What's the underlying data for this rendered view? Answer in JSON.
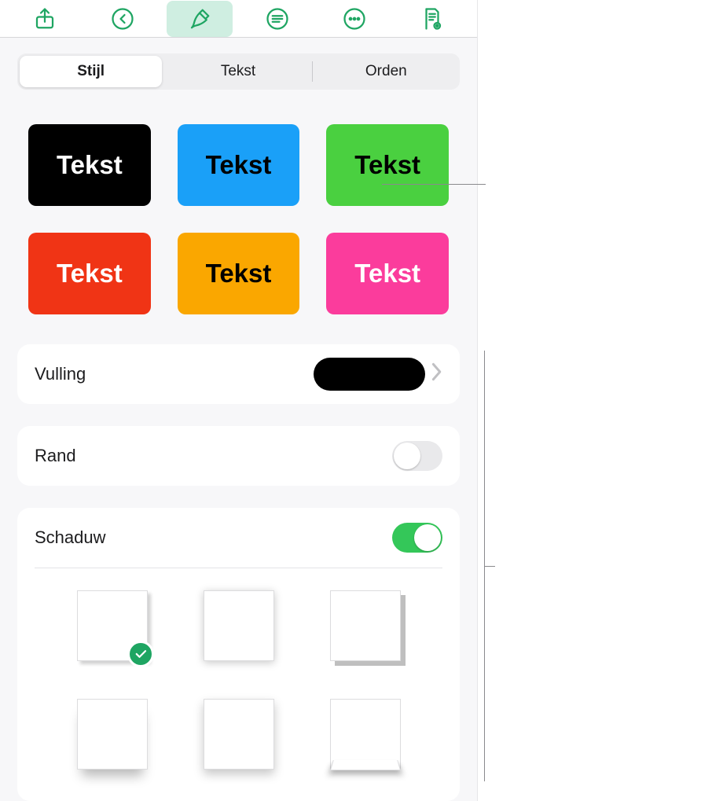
{
  "toolbar": {
    "icons": [
      "share-icon",
      "undo-icon",
      "format-brush-icon",
      "menu-lines-icon",
      "more-icon",
      "document-view-icon"
    ],
    "active_index": 2,
    "color": "#1ea562"
  },
  "tabs": {
    "items": [
      {
        "label": "Stijl",
        "active": true
      },
      {
        "label": "Tekst",
        "active": false
      },
      {
        "label": "Orden",
        "active": false
      }
    ]
  },
  "presets": [
    {
      "label": "Tekst",
      "bg": "#000000",
      "fg": "#ffffff"
    },
    {
      "label": "Tekst",
      "bg": "#1aa0f8",
      "fg": "#000000"
    },
    {
      "label": "Tekst",
      "bg": "#4ad040",
      "fg": "#000000"
    },
    {
      "label": "Tekst",
      "bg": "#f03415",
      "fg": "#ffffff"
    },
    {
      "label": "Tekst",
      "bg": "#faa700",
      "fg": "#000000"
    },
    {
      "label": "Tekst",
      "bg": "#fb3c9c",
      "fg": "#ffffff"
    }
  ],
  "settings": {
    "fill": {
      "label": "Vulling",
      "swatch_color": "#000000"
    },
    "border": {
      "label": "Rand",
      "on": false
    },
    "shadow": {
      "label": "Schaduw",
      "on": true,
      "selected_index": 0
    }
  }
}
